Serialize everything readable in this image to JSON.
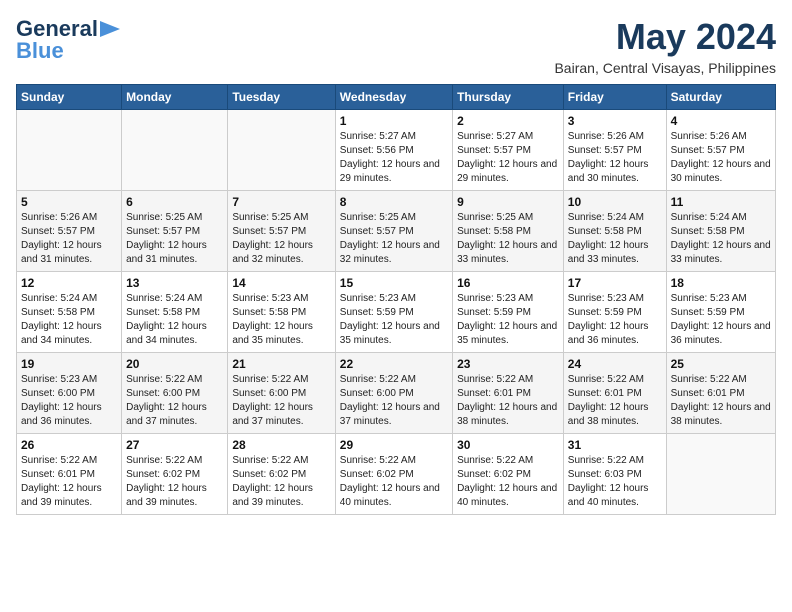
{
  "logo": {
    "line1": "General",
    "line2": "Blue"
  },
  "title": "May 2024",
  "location": "Bairan, Central Visayas, Philippines",
  "days_header": [
    "Sunday",
    "Monday",
    "Tuesday",
    "Wednesday",
    "Thursday",
    "Friday",
    "Saturday"
  ],
  "weeks": [
    [
      {
        "day": "",
        "info": ""
      },
      {
        "day": "",
        "info": ""
      },
      {
        "day": "",
        "info": ""
      },
      {
        "day": "1",
        "info": "Sunrise: 5:27 AM\nSunset: 5:56 PM\nDaylight: 12 hours and 29 minutes."
      },
      {
        "day": "2",
        "info": "Sunrise: 5:27 AM\nSunset: 5:57 PM\nDaylight: 12 hours and 29 minutes."
      },
      {
        "day": "3",
        "info": "Sunrise: 5:26 AM\nSunset: 5:57 PM\nDaylight: 12 hours and 30 minutes."
      },
      {
        "day": "4",
        "info": "Sunrise: 5:26 AM\nSunset: 5:57 PM\nDaylight: 12 hours and 30 minutes."
      }
    ],
    [
      {
        "day": "5",
        "info": "Sunrise: 5:26 AM\nSunset: 5:57 PM\nDaylight: 12 hours and 31 minutes."
      },
      {
        "day": "6",
        "info": "Sunrise: 5:25 AM\nSunset: 5:57 PM\nDaylight: 12 hours and 31 minutes."
      },
      {
        "day": "7",
        "info": "Sunrise: 5:25 AM\nSunset: 5:57 PM\nDaylight: 12 hours and 32 minutes."
      },
      {
        "day": "8",
        "info": "Sunrise: 5:25 AM\nSunset: 5:57 PM\nDaylight: 12 hours and 32 minutes."
      },
      {
        "day": "9",
        "info": "Sunrise: 5:25 AM\nSunset: 5:58 PM\nDaylight: 12 hours and 33 minutes."
      },
      {
        "day": "10",
        "info": "Sunrise: 5:24 AM\nSunset: 5:58 PM\nDaylight: 12 hours and 33 minutes."
      },
      {
        "day": "11",
        "info": "Sunrise: 5:24 AM\nSunset: 5:58 PM\nDaylight: 12 hours and 33 minutes."
      }
    ],
    [
      {
        "day": "12",
        "info": "Sunrise: 5:24 AM\nSunset: 5:58 PM\nDaylight: 12 hours and 34 minutes."
      },
      {
        "day": "13",
        "info": "Sunrise: 5:24 AM\nSunset: 5:58 PM\nDaylight: 12 hours and 34 minutes."
      },
      {
        "day": "14",
        "info": "Sunrise: 5:23 AM\nSunset: 5:58 PM\nDaylight: 12 hours and 35 minutes."
      },
      {
        "day": "15",
        "info": "Sunrise: 5:23 AM\nSunset: 5:59 PM\nDaylight: 12 hours and 35 minutes."
      },
      {
        "day": "16",
        "info": "Sunrise: 5:23 AM\nSunset: 5:59 PM\nDaylight: 12 hours and 35 minutes."
      },
      {
        "day": "17",
        "info": "Sunrise: 5:23 AM\nSunset: 5:59 PM\nDaylight: 12 hours and 36 minutes."
      },
      {
        "day": "18",
        "info": "Sunrise: 5:23 AM\nSunset: 5:59 PM\nDaylight: 12 hours and 36 minutes."
      }
    ],
    [
      {
        "day": "19",
        "info": "Sunrise: 5:23 AM\nSunset: 6:00 PM\nDaylight: 12 hours and 36 minutes."
      },
      {
        "day": "20",
        "info": "Sunrise: 5:22 AM\nSunset: 6:00 PM\nDaylight: 12 hours and 37 minutes."
      },
      {
        "day": "21",
        "info": "Sunrise: 5:22 AM\nSunset: 6:00 PM\nDaylight: 12 hours and 37 minutes."
      },
      {
        "day": "22",
        "info": "Sunrise: 5:22 AM\nSunset: 6:00 PM\nDaylight: 12 hours and 37 minutes."
      },
      {
        "day": "23",
        "info": "Sunrise: 5:22 AM\nSunset: 6:01 PM\nDaylight: 12 hours and 38 minutes."
      },
      {
        "day": "24",
        "info": "Sunrise: 5:22 AM\nSunset: 6:01 PM\nDaylight: 12 hours and 38 minutes."
      },
      {
        "day": "25",
        "info": "Sunrise: 5:22 AM\nSunset: 6:01 PM\nDaylight: 12 hours and 38 minutes."
      }
    ],
    [
      {
        "day": "26",
        "info": "Sunrise: 5:22 AM\nSunset: 6:01 PM\nDaylight: 12 hours and 39 minutes."
      },
      {
        "day": "27",
        "info": "Sunrise: 5:22 AM\nSunset: 6:02 PM\nDaylight: 12 hours and 39 minutes."
      },
      {
        "day": "28",
        "info": "Sunrise: 5:22 AM\nSunset: 6:02 PM\nDaylight: 12 hours and 39 minutes."
      },
      {
        "day": "29",
        "info": "Sunrise: 5:22 AM\nSunset: 6:02 PM\nDaylight: 12 hours and 40 minutes."
      },
      {
        "day": "30",
        "info": "Sunrise: 5:22 AM\nSunset: 6:02 PM\nDaylight: 12 hours and 40 minutes."
      },
      {
        "day": "31",
        "info": "Sunrise: 5:22 AM\nSunset: 6:03 PM\nDaylight: 12 hours and 40 minutes."
      },
      {
        "day": "",
        "info": ""
      }
    ]
  ]
}
